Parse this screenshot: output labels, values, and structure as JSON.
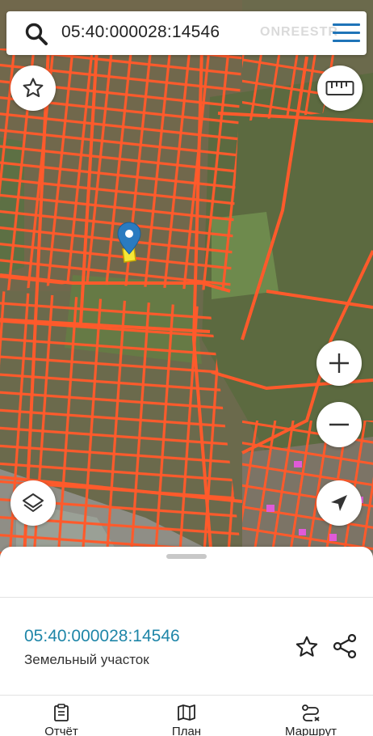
{
  "search": {
    "query": "05:40:000028:14546",
    "brand": "ONREESTR"
  },
  "map": {
    "parcel_line_color": "#ff5a2b",
    "marker_color": "#2a7bc0",
    "selected_parcel_color": "#f5e836",
    "buttons": {
      "favorites": "star-icon",
      "ruler": "ruler-icon",
      "zoom_in": "plus-icon",
      "zoom_out": "minus-icon",
      "layers": "layers-icon",
      "locate": "navigation-arrow-icon"
    }
  },
  "parcel": {
    "number": "05:40:000028:14546",
    "type": "Земельный участок"
  },
  "tabs": [
    {
      "label": "Отчёт",
      "icon": "report-icon"
    },
    {
      "label": "План",
      "icon": "map-icon"
    },
    {
      "label": "Маршрут",
      "icon": "route-icon"
    }
  ]
}
